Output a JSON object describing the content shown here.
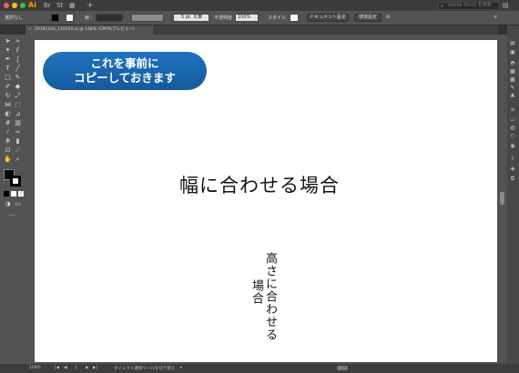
{
  "app": {
    "name": "Ai",
    "stock_search_placeholder": "Adobe Stock を検索"
  },
  "control_bar": {
    "selection": "選択なし",
    "stroke_label": "線 :",
    "brush": "5 pt. 丸筆",
    "opacity_label": "不透明度",
    "opacity_value": "100%",
    "style_label": "スタイル",
    "doc_setup_button": "ドキュメント設定",
    "prefs_button": "環境設定"
  },
  "document_tab": {
    "title": "20181104_120020.ai @ 148% (CMYK/プレビュー)"
  },
  "canvas": {
    "callout": {
      "line1": "これを事前に",
      "line2": "コピーしておきます"
    },
    "horizontal_text": "幅に合わせる場合",
    "vertical_text": {
      "col1": "高さに合わせる",
      "col2": "場合"
    }
  },
  "status_bar": {
    "zoom": "148%",
    "page": "1",
    "tool_hint": "ダイレクト選択ツールを切り替え"
  },
  "colors": {
    "callout_blue": "#1a69b3",
    "ai_orange": "#ff9a00"
  }
}
